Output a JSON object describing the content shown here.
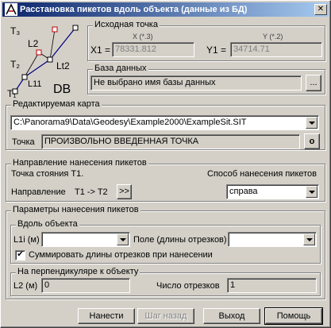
{
  "window": {
    "title": "Расстановка пикетов вдоль объекта (данные из БД)",
    "close_symbol": "✕"
  },
  "diagram": {
    "labels": {
      "t3": "T₃",
      "l2": "L2",
      "t2": "T₂",
      "lt2": "Lt2",
      "l11": "L11",
      "t1": "T₁",
      "db": "DB"
    }
  },
  "source_point": {
    "title": "Исходная точка",
    "x_caption": "X (*.3)",
    "y_caption": "Y (*.2)",
    "x1_label": "X1 =",
    "x1_value": "78331.812",
    "y1_label": "Y1 =",
    "y1_value": "34714.71"
  },
  "database": {
    "title": "База данных",
    "value": "Не выбрано имя базы данных",
    "browse_label": "..."
  },
  "map": {
    "title": "Редактируемая карта",
    "path": "C:\\Panorama9\\Data\\Geodesy\\Example2000\\ExampleSit.SIT",
    "point_label": "Точка",
    "point_value": "ПРОИЗВОЛЬНО ВВЕДЕННАЯ ТОЧКА",
    "point_button": "o"
  },
  "direction": {
    "title": "Направление нанесения пикетов",
    "station_text": "Точка стояния T1.",
    "method_label": "Способ нанесения пикетов",
    "direction_label": "Направление",
    "direction_value": "T1 -> T2",
    "swap_button": ">>",
    "method_value": "справа"
  },
  "params": {
    "title": "Параметры нанесения пикетов",
    "along": {
      "title": "Вдоль объекта",
      "l1_label": "L1i (м)",
      "l1_value": "",
      "field_label": "Поле (длины отрезков)",
      "field_value": "",
      "sum_checked": "✔",
      "sum_label": "Суммировать длины отрезков при нанесении"
    },
    "perpendicular": {
      "title": "На перпендикуляре к объекту",
      "l2_label": "L2 (м)",
      "l2_value": "0",
      "count_label": "Число отрезков",
      "count_value": "1"
    }
  },
  "buttons": {
    "apply": "Нанести",
    "step_back": "Шаг назад",
    "exit": "Выход",
    "help": "Помощь"
  }
}
